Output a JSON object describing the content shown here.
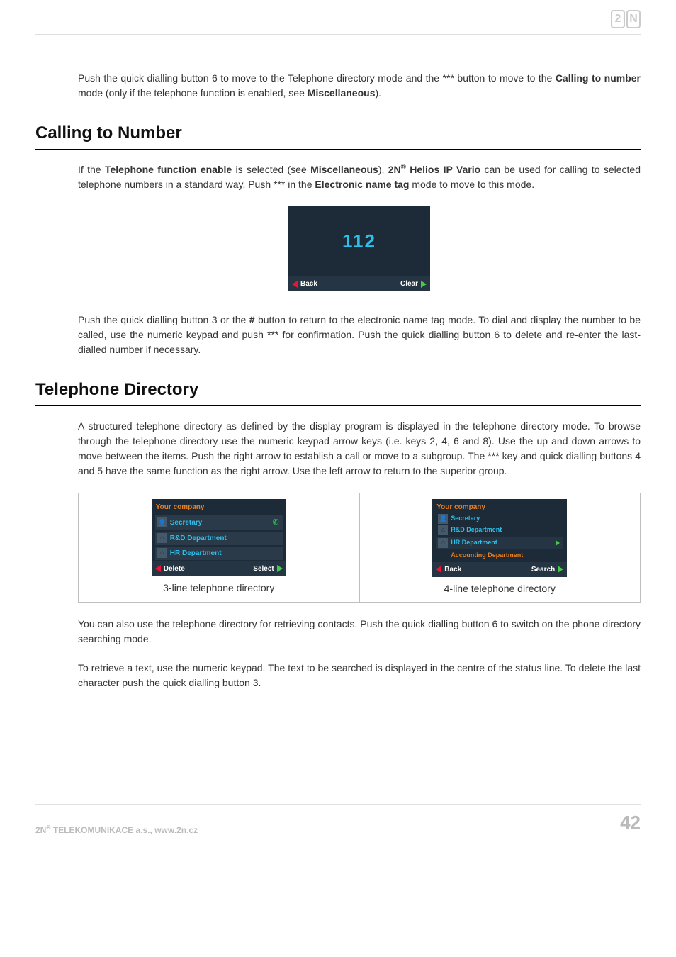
{
  "header": {
    "logo": "2N"
  },
  "intro": {
    "p1_a": "Push the quick dialling button 6 to move to the Telephone directory mode and the *** button to move to the ",
    "p1_b": "Calling to number",
    "p1_c": " mode (only if the telephone function is enabled, see ",
    "p1_d": "Miscellaneous",
    "p1_e": ")."
  },
  "section1": {
    "heading": "Calling to Number",
    "p1_a": "If the ",
    "p1_b": "Telephone function enable",
    "p1_c": " is selected (see ",
    "p1_d": "Miscellaneous",
    "p1_e": "), ",
    "p1_f": "2N",
    "p1_g": "®",
    "p1_h": " Helios IP Vario",
    "p1_i": " can be used for calling to selected telephone numbers in a standard way. Push *** in the ",
    "p1_j": "Electronic name tag",
    "p1_k": " mode to move to this mode.",
    "device": {
      "number": "112",
      "back": "Back",
      "clear": "Clear"
    },
    "p2_a": "Push the quick dialling button 3 or the ",
    "p2_b": "#",
    "p2_c": " button to return to the electronic name tag mode. To dial and display the number to be called, use the numeric keypad and push *** for confirmation. Push the quick dialling button 6 to delete and re-enter the last-dialled number if necessary."
  },
  "section2": {
    "heading": "Telephone Directory",
    "p1": "A structured telephone directory as defined by the display program is displayed in the telephone directory mode. To browse through the telephone directory use the numeric keypad arrow keys (i.e. keys 2, 4, 6 and 8). Use the up and down arrows to move between the items. Push the right arrow to establish a call or move to a subgroup. The *** key and quick dialling buttons 4 and 5 have the same function as the right arrow. Use the left arrow to return to the superior group.",
    "device3": {
      "title": "Your company",
      "rows": [
        {
          "label": "Secretary",
          "icon": "person",
          "trail": "phone"
        },
        {
          "label": "R&D Department",
          "icon": "house"
        },
        {
          "label": "HR Department",
          "icon": "house"
        }
      ],
      "back": "Delete",
      "action": "Select"
    },
    "device4": {
      "title": "Your company",
      "rows": [
        {
          "label": "Secretary",
          "icon": "person"
        },
        {
          "label": "R&D Department",
          "icon": "house"
        },
        {
          "label": "HR Department",
          "icon": "house",
          "selected": true
        },
        {
          "label": "Accounting Department",
          "plain": true
        }
      ],
      "back": "Back",
      "action": "Search"
    },
    "caption3": "3-line telephone directory",
    "caption4": "4-line telephone directory",
    "p2": "You can also use the telephone directory for retrieving contacts. Push the quick dialling button 6 to switch on the phone directory searching mode.",
    "p3": "To retrieve a text, use the numeric keypad. The text to be searched is displayed in the centre of the status line. To delete the last character push the quick dialling button 3."
  },
  "footer": {
    "left_a": "2N",
    "left_b": "®",
    "left_c": " TELEKOMUNIKACE a.s., www.2n.cz",
    "page": "42"
  }
}
